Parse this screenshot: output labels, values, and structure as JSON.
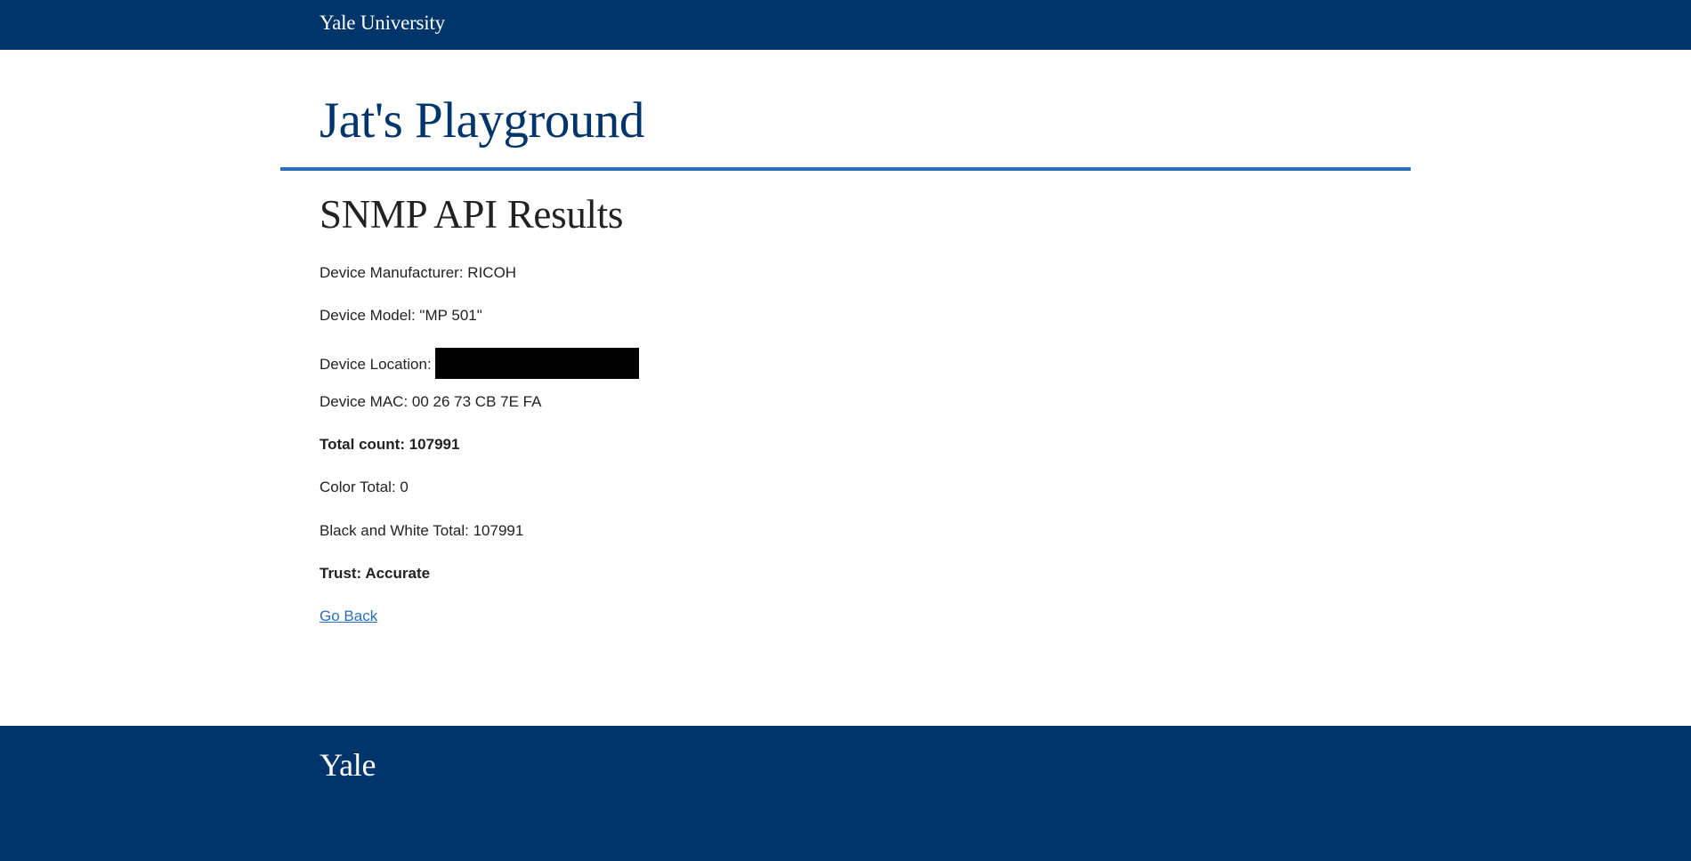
{
  "header": {
    "brand": "Yale University"
  },
  "site": {
    "title": "Jat's Playground"
  },
  "main": {
    "heading": "SNMP API Results",
    "manufacturer": "Device Manufacturer: RICOH",
    "model": "Device Model: \"MP 501\"",
    "location_label": "Device Location:",
    "mac": "Device MAC: 00 26 73 CB 7E FA",
    "total_count": "Total count: 107991",
    "color_total": "Color Total: 0",
    "bw_total": "Black and White Total: 107991",
    "trust": "Trust: Accurate",
    "go_back": "Go Back"
  },
  "footer": {
    "wordmark": "Yale"
  },
  "colors": {
    "yale_blue": "#00356b",
    "accent_blue": "#286dc0",
    "text": "#222222"
  }
}
